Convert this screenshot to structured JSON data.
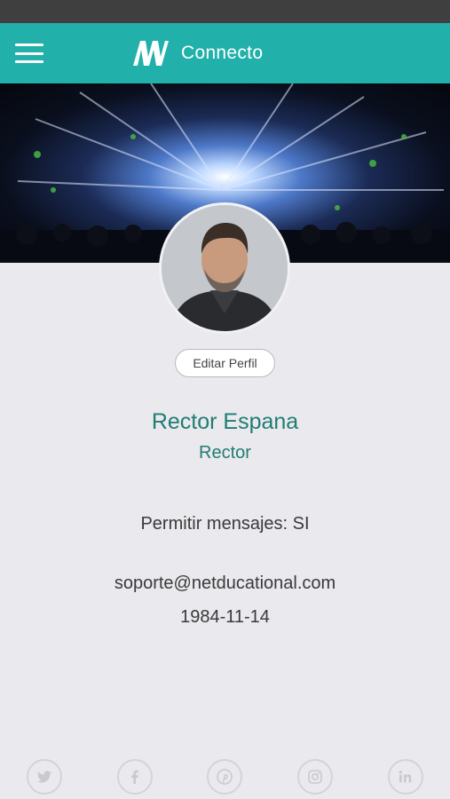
{
  "app": {
    "title": "Connecto",
    "accent_color": "#21b0aa"
  },
  "profile": {
    "edit_label": "Editar Perfil",
    "name": "Rector Espana",
    "role": "Rector",
    "allow_messages": "Permitir mensajes: SI",
    "email": "soporte@netducational.com",
    "birthdate": "1984-11-14",
    "name_color": "#217d73"
  },
  "social": [
    "twitter-icon",
    "facebook-icon",
    "pinterest-icon",
    "instagram-icon",
    "linkedin-icon"
  ]
}
